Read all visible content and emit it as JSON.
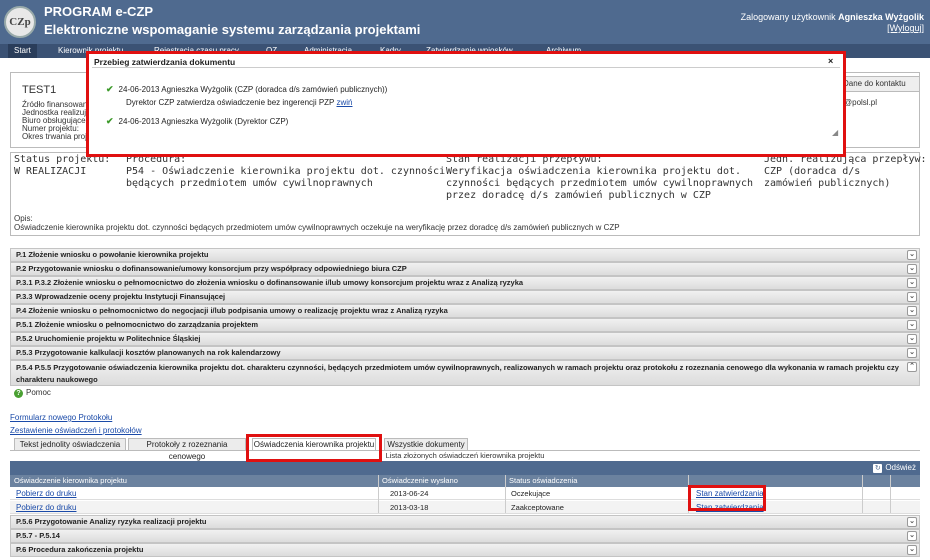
{
  "header": {
    "app_title": "PROGRAM e-CZP",
    "app_subtitle": "Elektroniczne wspomaganie systemu zarządzania projektami",
    "logo_text": "CZp",
    "user_prefix": "Zalogowany użytkownik",
    "user_name": "Agnieszka Wyżgolik",
    "logout": "[Wyloguj]"
  },
  "nav": {
    "items": [
      "Start",
      "Kierownik projektu",
      "Rejestracja czasu pracy",
      "OZ",
      "Administracja",
      "Kadry",
      "Zatwierdzanie wniosków",
      "Archiwum"
    ]
  },
  "project": {
    "code": "TEST",
    "code_num": "1",
    "lines": [
      "Źródło finansowania:",
      "Jednostka realizująca:",
      "Biuro obsługujące:",
      "Numer projektu:",
      "Okres trwania projektu:"
    ],
    "contact_button": "Dane do kontaktu",
    "contact_email": "@polsl.pl"
  },
  "status": {
    "col1_label": "Status projektu:",
    "col1_value": "W REALIZACJI",
    "col2_label": "Procedura:",
    "col2_value": [
      "P54 - Oświadczenie kierownika projektu dot. czynności",
      "będących przedmiotem umów cywilnoprawnych"
    ],
    "col3_label": "Stan realizacji przepływu:",
    "col3_value": [
      "Weryfikacja oświadczenia kierownika projektu dot.",
      "czynności będących przedmiotem umów cywilnoprawnych",
      "przez doradcę d/s zamówień publicznych w CZP"
    ],
    "col4_label": "Jedn. realizująca przepływ:",
    "col4_value": [
      "CZP (doradca d/s",
      "zamówień publicznych)"
    ],
    "opis_label": "Opis:",
    "opis_text": "Oświadczenie kierownika projektu dot. czynności będących przedmiotem umów cywilnoprawnych oczekuje na weryfikację przez doradcę d/s zamówień publicznych w CZP"
  },
  "accordion": {
    "items": [
      "P.1 Złożenie wniosku o powołanie kierownika projektu",
      "P.2 Przygotowanie wniosku o dofinansowanie/umowy konsorcjum przy współpracy odpowiedniego biura CZP",
      "P.3.1 P.3.2 Złożenie wniosku o pełnomocnictwo do złożenia wniosku o dofinansowanie i/lub umowy konsorcjum projektu wraz z Analizą ryzyka",
      "P.3.3 Wprowadzenie oceny projektu Instytucji Finansującej",
      "P.4 Złożenie wniosku o pełnomocnictwo do negocjacji i/lub podpisania umowy o realizację projektu wraz z Analizą ryzyka",
      "P.5.1 Złożenie wniosku o pełnomocnictwo do zarządzania projektem",
      "P.5.2 Uruchomienie projektu w Politechnice Śląskiej",
      "P.5.3 Przygotowanie kalkulacji kosztów planowanych na rok kalendarzowy"
    ],
    "open_item_line1": "P.5.4 P.5.5 Przygotowanie oświadczenia kierownika projektu dot. charakteru czynności, będących przedmiotem umów cywilnoprawnych, realizowanych w ramach projektu oraz protokołu z rozeznania cenowego dla wykonania w ramach projektu czynności nie mającej",
    "open_item_line2": "charakteru naukowego",
    "bottom_items": [
      "P.5.6 Przygotowanie Analizy ryzyka realizacji projektu",
      "P.5.7 - P.5.14",
      "P.6 Procedura zakończenia projektu"
    ]
  },
  "section": {
    "help": "Pomoc",
    "help_icon": "?",
    "link_new_protocol": "Formularz nowego Protokołu",
    "link_summary": "Zestawienie oświadczeń i protokołów",
    "tabs": [
      "Tekst jednolity oświadczenia",
      "Protokoły z rozeznania cenowego",
      "Oświadczenia kierownika projektu",
      "Wszystkie dokumenty"
    ],
    "list_caption": "Lista złożonych oświadczeń kierownika projektu",
    "refresh": "Odśwież"
  },
  "table": {
    "headers": [
      "Oświadczenie kierownika projektu",
      "Oświadczenie wysłano",
      "Status oświadczenia",
      ""
    ],
    "rows": [
      {
        "doc": "Pobierz do druku",
        "sent": "2013-06-24",
        "status": "Oczekujące",
        "action": "Stan zatwierdzania"
      },
      {
        "doc": "Pobierz do druku",
        "sent": "2013-03-18",
        "status": "Zaakceptowane",
        "action": "Stan zatwierdzania"
      }
    ]
  },
  "modal": {
    "title": "Przebieg zatwierdzania dokumentu",
    "close": "×",
    "entry1": "24-06-2013 Agnieszka Wyżgolik (CZP (doradca d/s zamówień publicznych))",
    "entry1_note": "Dyrektor CZP zatwierdza oświadczenie bez ingerencji PZP",
    "entry1_toggle": "zwiń",
    "entry2": "24-06-2013 Agnieszka Wyżgolik (Dyrektor CZP)",
    "check": "✔"
  },
  "colors": {
    "header_bg": "#4f6a8f",
    "highlight": "#e01010",
    "check": "#3c9a2a",
    "link": "#1a4aa8"
  }
}
